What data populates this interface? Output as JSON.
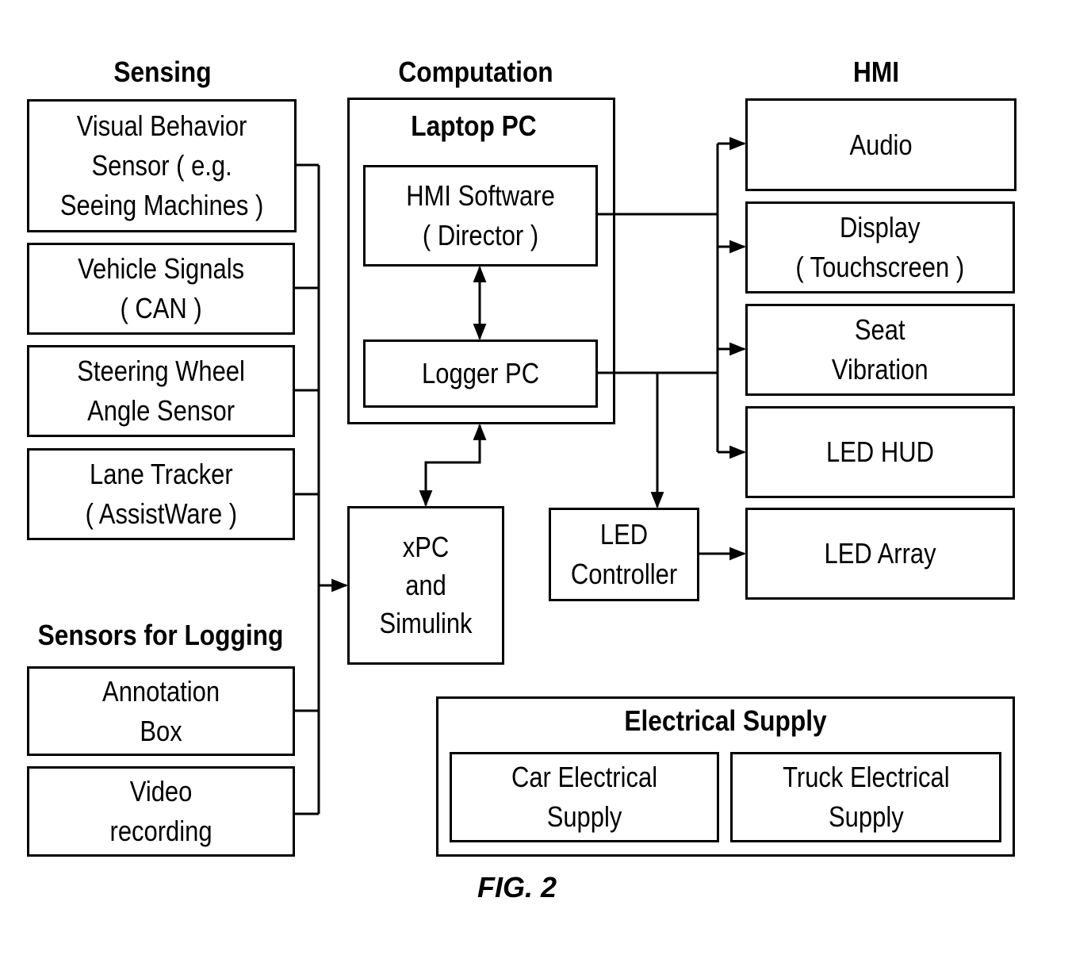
{
  "figure_label": "FIG. 2",
  "columns": {
    "sensing": "Sensing",
    "computation": "Computation",
    "hmi": "HMI"
  },
  "sensing_blocks": [
    {
      "label": "Visual Behavior\nSensor ( e.g.\nSeeing Machines )"
    },
    {
      "label": "Vehicle Signals\n( CAN )"
    },
    {
      "label": "Steering Wheel\nAngle Sensor"
    },
    {
      "label": "Lane Tracker\n( AssistWare )"
    }
  ],
  "logging": {
    "title": "Sensors for Logging",
    "blocks": [
      {
        "label": "Annotation\nBox"
      },
      {
        "label": "Video\nrecording"
      }
    ]
  },
  "computation": {
    "laptop_title": "Laptop PC",
    "hmi_software": "HMI Software\n( Director )",
    "logger_pc": "Logger PC",
    "xpc": "xPC\nand\nSimulink",
    "led_controller": "LED\nController"
  },
  "hmi_blocks": [
    {
      "label": "Audio"
    },
    {
      "label": "Display\n( Touchscreen )"
    },
    {
      "label": "Seat\nVibration"
    },
    {
      "label": "LED HUD"
    },
    {
      "label": "LED Array"
    }
  ],
  "electrical": {
    "title": "Electrical Supply",
    "car": "Car Electrical\nSupply",
    "truck": "Truck Electrical\nSupply"
  }
}
